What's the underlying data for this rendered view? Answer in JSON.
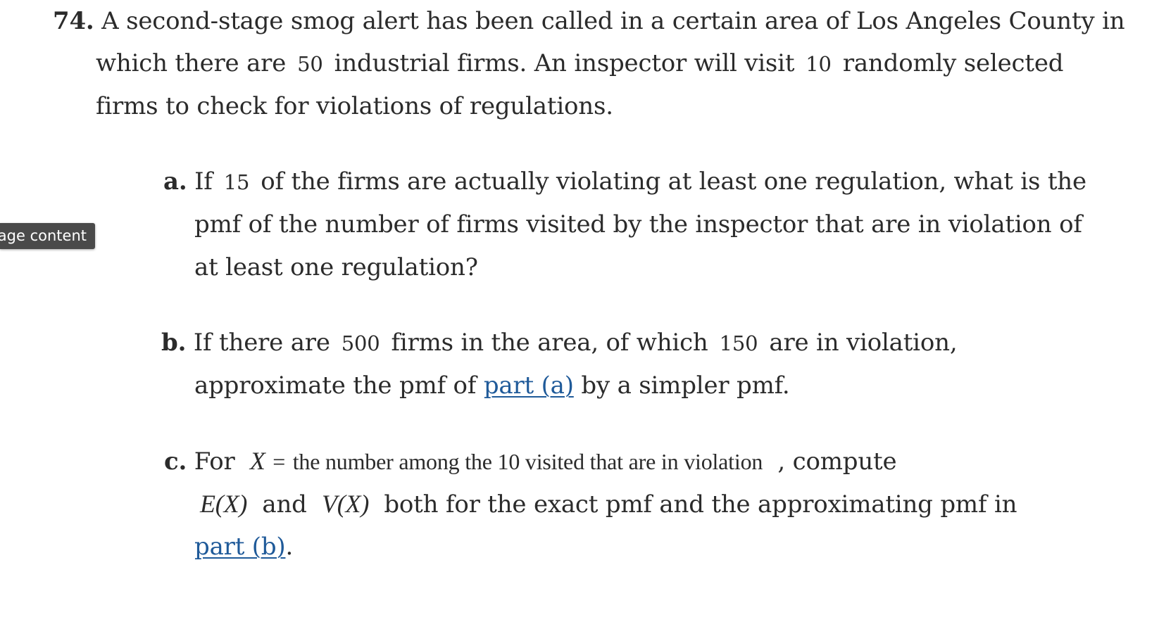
{
  "problem": {
    "number": "74.",
    "intro": {
      "line1": "A second-stage smog alert has been called in a certain area of Los Angeles County in",
      "line2_before": "which there are",
      "firms_total": "50",
      "line2_middle": "industrial firms. An inspector will visit",
      "visit_count": "10",
      "line2_after": "randomly selected",
      "line3": "firms to check for violations of regulations."
    },
    "parts": {
      "a": {
        "label": "a.",
        "line1_before": "If",
        "violating": "15",
        "line1_after": "of the firms are actually violating at least one regulation, what is the",
        "line2": "pmf of the number of firms visited by the inspector that are in violation of",
        "line3": "at least one regulation?"
      },
      "b": {
        "label": "b.",
        "line1_before": "If there are",
        "firms_total": "500",
        "line1_middle": "firms in the area, of which",
        "violating": "150",
        "line1_after": "are in violation,",
        "line2_before": "approximate the pmf of",
        "link_text": "part (a)",
        "line2_after": "by a simpler pmf."
      },
      "c": {
        "label": "c.",
        "line1_before": "For",
        "var_x": "X",
        "equals": "=",
        "definition": "the number among the 10 visited that are in violation",
        "line1_after": ", compute",
        "expectation": "E(X)",
        "and": "and",
        "variance": "V(X)",
        "line2_after": "both for the exact pmf and the approximating pmf in",
        "link_text": "part (b)",
        "period": "."
      }
    }
  },
  "sidebar_tab": {
    "label": "age content"
  }
}
